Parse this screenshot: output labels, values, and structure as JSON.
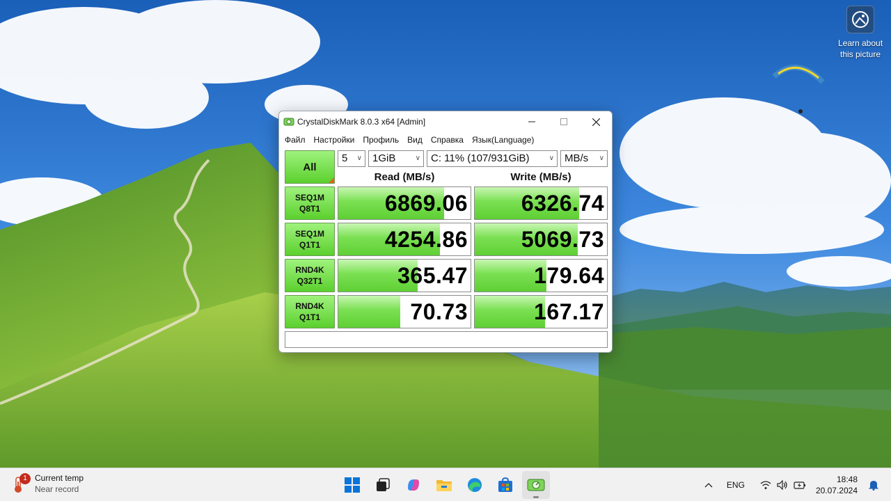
{
  "desktop": {
    "learn_label": "Learn about this picture",
    "learn_icon": "camera-aperture-icon"
  },
  "window": {
    "title": "CrystalDiskMark 8.0.3 x64 [Admin]",
    "icon": "crystaldiskmark-icon",
    "menu": [
      "Файл",
      "Настройки",
      "Профиль",
      "Вид",
      "Справка",
      "Язык(Language)"
    ],
    "all_label": "All",
    "count": "5",
    "size": "1GiB",
    "drive": "C: 11% (107/931GiB)",
    "unit": "MB/s",
    "read_header": "Read (MB/s)",
    "write_header": "Write (MB/s)",
    "rows": [
      {
        "line1": "SEQ1M",
        "line2": "Q8T1",
        "read": "6869.06",
        "write": "6326.74",
        "read_fill": 0.8,
        "write_fill": 0.79
      },
      {
        "line1": "SEQ1M",
        "line2": "Q1T1",
        "read": "4254.86",
        "write": "5069.73",
        "read_fill": 0.77,
        "write_fill": 0.78
      },
      {
        "line1": "RND4K",
        "line2": "Q32T1",
        "read": "365.47",
        "write": "179.64",
        "read_fill": 0.6,
        "write_fill": 0.54
      },
      {
        "line1": "RND4K",
        "line2": "Q1T1",
        "read": "70.73",
        "write": "167.17",
        "read_fill": 0.47,
        "write_fill": 0.53
      }
    ],
    "comment": ""
  },
  "taskbar": {
    "weather_title": "Current temp",
    "weather_sub": "Near record",
    "weather_badge": "1",
    "apps": [
      "windows-start-icon",
      "task-view-icon",
      "copilot-icon",
      "file-explorer-icon",
      "edge-icon",
      "store-icon",
      "crystaldiskmark-icon"
    ],
    "language": "ENG",
    "time": "18:48",
    "date": "20.07.2024"
  }
}
